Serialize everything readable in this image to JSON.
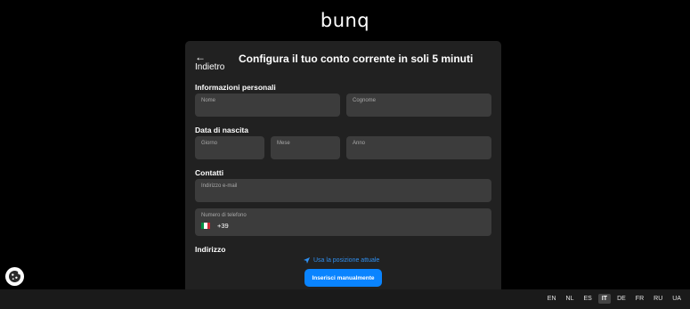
{
  "brand": "bunq",
  "header": {
    "back_arrow": "←",
    "back_label": "Indietro",
    "title": "Configura il tuo conto corrente in soli 5 minuti"
  },
  "sections": {
    "personal": "Informazioni personali",
    "birth": "Data di nascita",
    "contacts": "Contatti",
    "address": "Indirizzo"
  },
  "fields": {
    "first_name": "Nome",
    "last_name": "Cognome",
    "day": "Giorno",
    "month": "Mese",
    "year": "Anno",
    "email": "Indirizzo e-mail",
    "phone": "Numero di telefono",
    "phone_code": "+39"
  },
  "address_actions": {
    "use_location": "Usa la posizione attuale",
    "manual": "Inserisci manualmente"
  },
  "languages": [
    "EN",
    "NL",
    "ES",
    "IT",
    "DE",
    "FR",
    "RU",
    "UA"
  ],
  "active_language": "IT",
  "icons": {
    "back": "back-arrow-icon",
    "location": "location-arrow-icon",
    "flag": "italy-flag-icon",
    "cookie": "cookie-icon"
  },
  "colors": {
    "accent": "#0a84ff",
    "link": "#2f8ff0",
    "card": "#212121",
    "field": "#3c3c3c",
    "background": "#000000"
  }
}
